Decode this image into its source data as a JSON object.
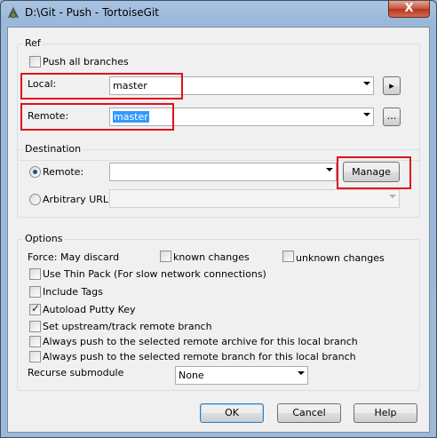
{
  "window": {
    "title": "D:\\Git - Push - TortoiseGit",
    "close_glyph": "X"
  },
  "ref": {
    "group_label": "Ref",
    "push_all_label": "Push all branches",
    "push_all_checked": false,
    "local_label": "Local:",
    "local_value": "master",
    "local_button_glyph": "▸",
    "remote_label": "Remote:",
    "remote_value": "master",
    "remote_button_label": "..."
  },
  "destination": {
    "group_label": "Destination",
    "remote_label": "Remote:",
    "remote_selected": true,
    "remote_value": "",
    "manage_label": "Manage",
    "url_label": "Arbitrary URL:",
    "url_value": ""
  },
  "options": {
    "group_label": "Options",
    "force_label": "Force: May discard",
    "known_changes_label": "known changes",
    "unknown_changes_label": "unknown changes",
    "thin_pack_label": "Use Thin Pack (For slow network connections)",
    "include_tags_label": "Include Tags",
    "autoload_putty_label": "Autoload Putty Key",
    "autoload_putty_checked": true,
    "set_upstream_label": "Set upstream/track remote branch",
    "push_remote_archive_label": "Always push to the selected remote archive for this local branch",
    "push_remote_branch_label": "Always push to the selected remote branch for this local branch",
    "recurse_label": "Recurse submodule",
    "recurse_value": "None"
  },
  "buttons": {
    "ok": "OK",
    "cancel": "Cancel",
    "help": "Help"
  },
  "colors": {
    "highlight_red": "#e0101e",
    "selection_blue": "#3399ff",
    "dialog_bg": "#f0f0f0"
  }
}
